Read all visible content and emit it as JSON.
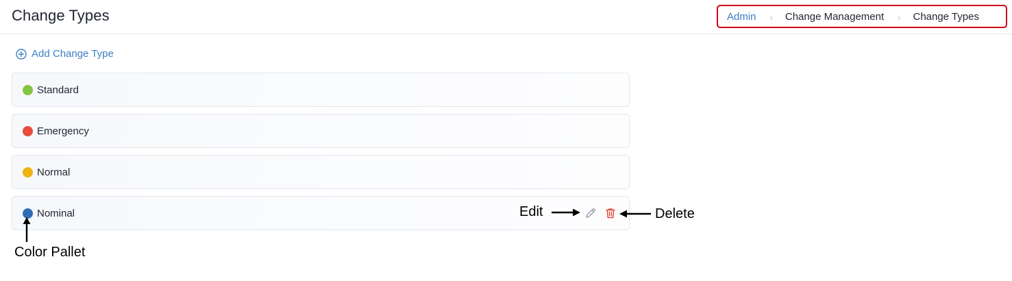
{
  "page": {
    "title": "Change Types"
  },
  "breadcrumb": [
    {
      "label": "Admin"
    },
    {
      "label": "Change Management"
    },
    {
      "label": "Change Types"
    }
  ],
  "separator": "›",
  "add_button": {
    "label": "Add Change Type",
    "icon": "plus-circle-icon"
  },
  "change_types": [
    {
      "name": "Standard",
      "color": "#84c441"
    },
    {
      "name": "Emergency",
      "color": "#e84c3d"
    },
    {
      "name": "Normal",
      "color": "#f0b20f"
    },
    {
      "name": "Nominal",
      "color": "#2f6db4"
    }
  ],
  "row_actions": {
    "edit_icon": "pencil-icon",
    "delete_icon": "trash-icon",
    "edit_color": "#8a93a3",
    "delete_color": "#e0493a"
  },
  "annotations": {
    "edit": "Edit",
    "delete": "Delete",
    "color_pallet": "Color Pallet"
  },
  "colors": {
    "link": "#3b7fc4",
    "highlight_border": "#d0021b"
  }
}
